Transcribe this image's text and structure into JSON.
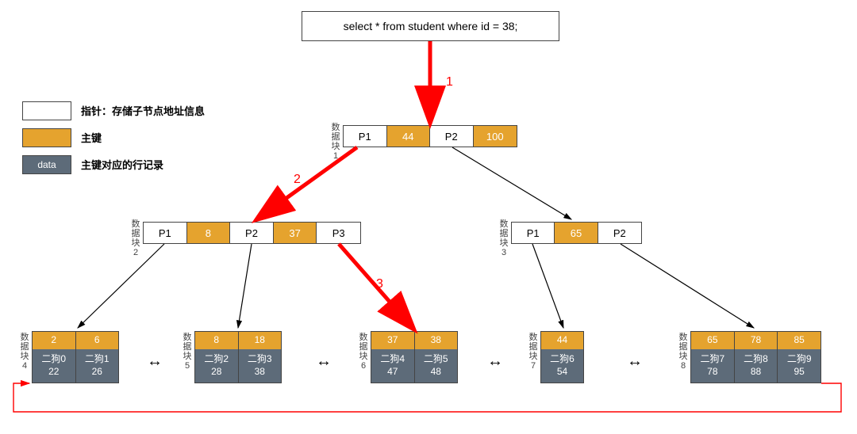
{
  "query": "select * from student where id = 38;",
  "legend": {
    "pointer_label": "指针：存储子节点地址信息",
    "key_label": "主键",
    "data_label": "主键对应的行记录",
    "data_swatch": "data"
  },
  "steps": {
    "s1": "1",
    "s2": "2",
    "s3": "3"
  },
  "block_labels": {
    "b1": "数<br>据<br>块<br>1",
    "b2": "数<br>据<br>块<br>2",
    "b3": "数<br>据<br>块<br>3",
    "b4": "数<br>据<br>块<br>4",
    "b5": "数<br>据<br>块<br>5",
    "b6": "数<br>据<br>块<br>6",
    "b7": "数<br>据<br>块<br>7",
    "b8": "数<br>据<br>块<br>8"
  },
  "chart_data": {
    "type": "tree",
    "root": {
      "block": 1,
      "cells": [
        "P1",
        44,
        "P2",
        100
      ]
    },
    "internal": [
      {
        "block": 2,
        "cells": [
          "P1",
          8,
          "P2",
          37,
          "P3"
        ]
      },
      {
        "block": 3,
        "cells": [
          "P1",
          65,
          "P2"
        ]
      }
    ],
    "leaves": [
      {
        "block": 4,
        "keys": [
          2,
          6
        ],
        "rows": [
          [
            "二狗0",
            22
          ],
          [
            "二狗1",
            26
          ]
        ]
      },
      {
        "block": 5,
        "keys": [
          8,
          18
        ],
        "rows": [
          [
            "二狗2",
            28
          ],
          [
            "二狗3",
            38
          ]
        ]
      },
      {
        "block": 6,
        "keys": [
          37,
          38
        ],
        "rows": [
          [
            "二狗4",
            47
          ],
          [
            "二狗5",
            48
          ]
        ]
      },
      {
        "block": 7,
        "keys": [
          44
        ],
        "rows": [
          [
            "二狗6",
            54
          ]
        ]
      },
      {
        "block": 8,
        "keys": [
          65,
          78,
          85
        ],
        "rows": [
          [
            "二狗7",
            78
          ],
          [
            "二狗8",
            88
          ],
          [
            "二狗9",
            95
          ]
        ]
      }
    ],
    "search_path": [
      1,
      2,
      3
    ]
  },
  "root": {
    "c0": "P1",
    "c1": "44",
    "c2": "P2",
    "c3": "100"
  },
  "n2": {
    "c0": "P1",
    "c1": "8",
    "c2": "P2",
    "c3": "37",
    "c4": "P3"
  },
  "n3": {
    "c0": "P1",
    "c1": "65",
    "c2": "P2"
  },
  "leaf4": {
    "k": [
      "2",
      "6"
    ],
    "r": [
      [
        "二狗0",
        "22"
      ],
      [
        "二狗1",
        "26"
      ]
    ]
  },
  "leaf5": {
    "k": [
      "8",
      "18"
    ],
    "r": [
      [
        "二狗2",
        "28"
      ],
      [
        "二狗3",
        "38"
      ]
    ]
  },
  "leaf6": {
    "k": [
      "37",
      "38"
    ],
    "r": [
      [
        "二狗4",
        "47"
      ],
      [
        "二狗5",
        "48"
      ]
    ]
  },
  "leaf7": {
    "k": [
      "44"
    ],
    "r": [
      [
        "二狗6",
        "54"
      ]
    ]
  },
  "leaf8": {
    "k": [
      "65",
      "78",
      "85"
    ],
    "r": [
      [
        "二狗7",
        "78"
      ],
      [
        "二狗8",
        "88"
      ],
      [
        "二狗9",
        "95"
      ]
    ]
  }
}
